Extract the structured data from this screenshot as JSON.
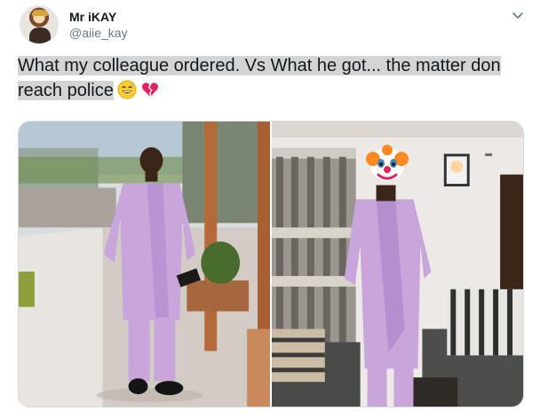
{
  "tweet": {
    "author_name": "Mr iKAY",
    "author_handle": "@aiie_kay",
    "text": "What my colleague ordered. Vs What he got... the matter don reach police",
    "emojis": [
      "grinning-face-with-sweat-icon",
      "broken-heart-icon"
    ]
  },
  "media": {
    "images": [
      {
        "name": "ordered-outfit-photo",
        "caption_icon": "none"
      },
      {
        "name": "received-outfit-photo",
        "caption_icon": "clown-face-icon"
      }
    ]
  },
  "colors": {
    "name": "#14171a",
    "handle": "#657786",
    "highlight": "#d4d4d4",
    "outfit": "#c8a6dc"
  }
}
